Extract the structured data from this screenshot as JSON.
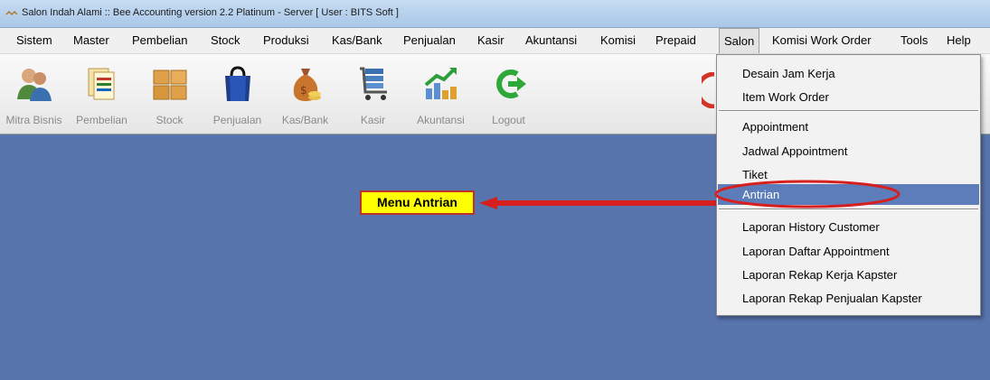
{
  "window": {
    "title": "Salon Indah Alami :: Bee Accounting version 2.2 Platinum - Server  [ User : BITS Soft ]"
  },
  "menubar": {
    "items": [
      "Sistem",
      "Master",
      "Pembelian",
      "Stock",
      "Produksi",
      "Kas/Bank",
      "Penjualan",
      "Kasir",
      "Akuntansi",
      "Komisi",
      "Prepaid",
      "Salon",
      "Komisi Work Order",
      "Tools",
      "Help"
    ],
    "active": "Salon"
  },
  "toolbar": {
    "items": [
      {
        "label": "Mitra Bisnis",
        "icon": "people-icon"
      },
      {
        "label": "Pembelian",
        "icon": "documents-icon"
      },
      {
        "label": "Stock",
        "icon": "boxes-icon"
      },
      {
        "label": "Penjualan",
        "icon": "shopping-bag-icon"
      },
      {
        "label": "Kas/Bank",
        "icon": "money-bag-icon"
      },
      {
        "label": "Kasir",
        "icon": "cart-icon"
      },
      {
        "label": "Akuntansi",
        "icon": "chart-up-icon"
      },
      {
        "label": "Logout",
        "icon": "logout-arrow-icon"
      }
    ]
  },
  "salon_menu": {
    "items": [
      "Desain Jam Kerja",
      "Item Work Order",
      "Appointment",
      "Jadwal Appointment",
      "Tiket",
      "Antrian",
      "Laporan History Customer",
      "Laporan Daftar Appointment",
      "Laporan Rekap Kerja Kapster",
      "Laporan Rekap Penjualan Kapster"
    ],
    "highlighted": "Antrian"
  },
  "callout": {
    "text": "Menu Antrian"
  },
  "colors": {
    "desktop": "#5874ad",
    "highlight": "#5c7dba",
    "callout_bg": "#ffff00",
    "callout_border": "#c0302a"
  }
}
